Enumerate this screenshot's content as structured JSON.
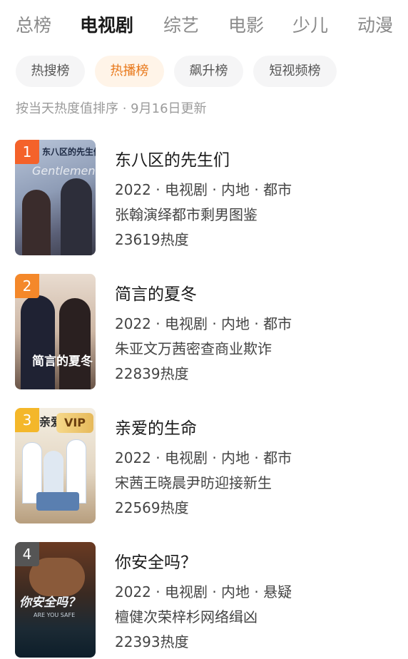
{
  "tabs": [
    {
      "label": "总榜"
    },
    {
      "label": "电视剧"
    },
    {
      "label": "综艺"
    },
    {
      "label": "电影"
    },
    {
      "label": "少儿"
    },
    {
      "label": "动漫"
    }
  ],
  "active_tab": "电视剧",
  "chips": [
    {
      "label": "热搜榜"
    },
    {
      "label": "热播榜"
    },
    {
      "label": "飙升榜"
    },
    {
      "label": "短视频榜"
    }
  ],
  "active_chip": "热播榜",
  "sort_info": "按当天热度值排序 · 9月16日更新",
  "colors": {
    "rank_1": "#f4622a",
    "rank_2": "#f4882a",
    "rank_3": "#f4b72a",
    "rank_other": "#555555",
    "chip_active_text": "#e8781a",
    "chip_active_bg": "#fff4e8"
  },
  "items": [
    {
      "rank": "1",
      "title": "东八区的先生们",
      "info": "2022 · 电视剧 · 内地 · 都市",
      "desc": "张翰演绎都市剩男图鉴",
      "heat": "23619热度",
      "poster_text": "东八区的先生们",
      "poster_sub": "Gentlemen Day"
    },
    {
      "rank": "2",
      "title": "简言的夏冬",
      "info": "2022 · 电视剧 · 内地 · 都市",
      "desc": "朱亚文万茜密查商业欺诈",
      "heat": "22839热度",
      "poster_text": "简言的夏冬"
    },
    {
      "rank": "3",
      "title": "亲爱的生命",
      "info": "2022 · 电视剧 · 内地 · 都市",
      "desc": "宋茜王晓晨尹昉迎接新生",
      "heat": "22569热度",
      "poster_text": "亲爱",
      "badge": "VIP"
    },
    {
      "rank": "4",
      "title": "你安全吗？",
      "info": "2022 · 电视剧 · 内地 · 悬疑",
      "desc": "檀健次荣梓杉网络缉凶",
      "heat": "22393热度",
      "poster_text": "你安全吗？",
      "poster_sub": "ARE YOU SAFE"
    }
  ]
}
